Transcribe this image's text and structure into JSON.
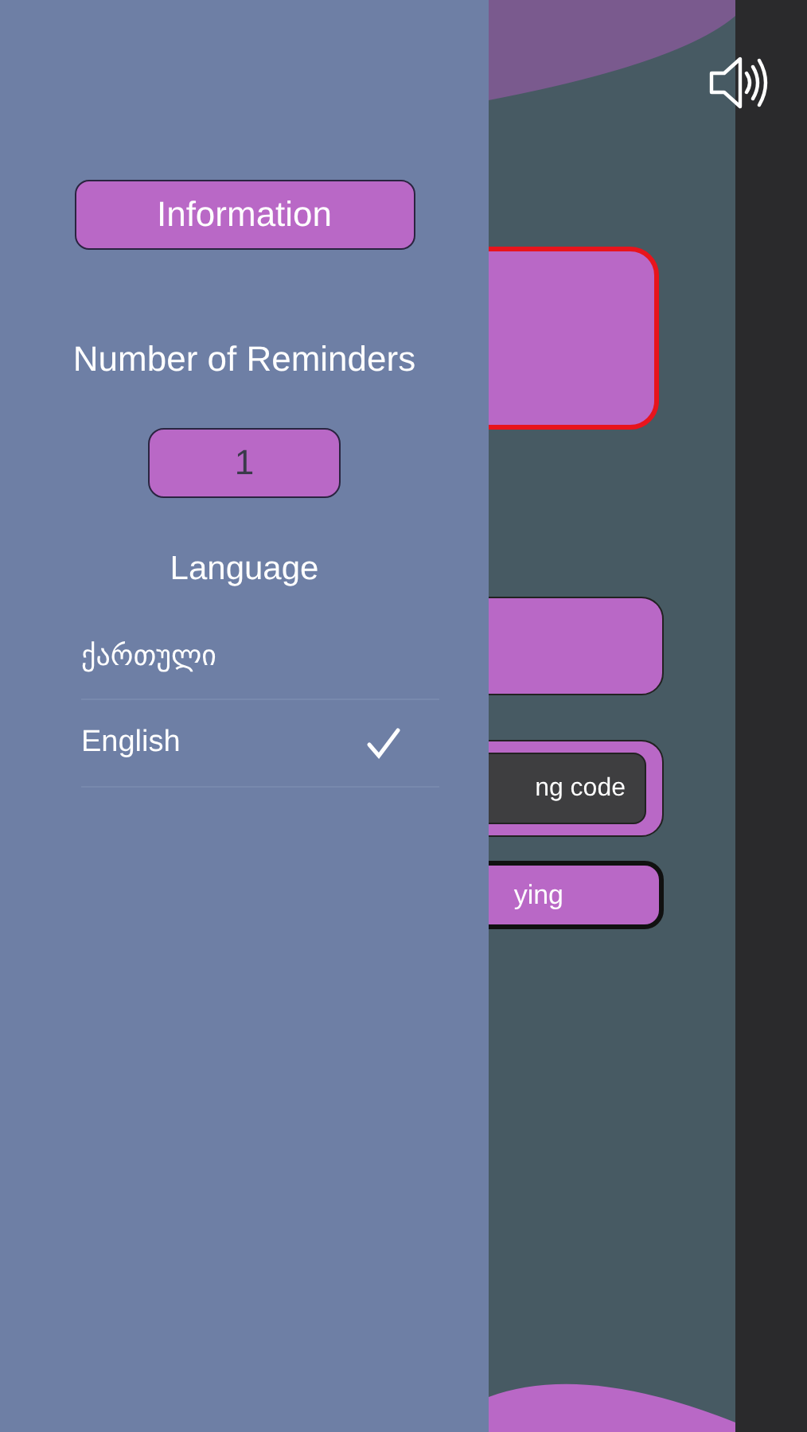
{
  "drawer": {
    "info_button": "Information",
    "reminders_title": "Number of Reminders",
    "reminders_value": "1",
    "language_title": "Language",
    "languages": [
      {
        "label": "ქართული",
        "selected": false
      },
      {
        "label": "English",
        "selected": true
      }
    ]
  },
  "main": {
    "code_field": "ng code",
    "action_button": "ying"
  }
}
